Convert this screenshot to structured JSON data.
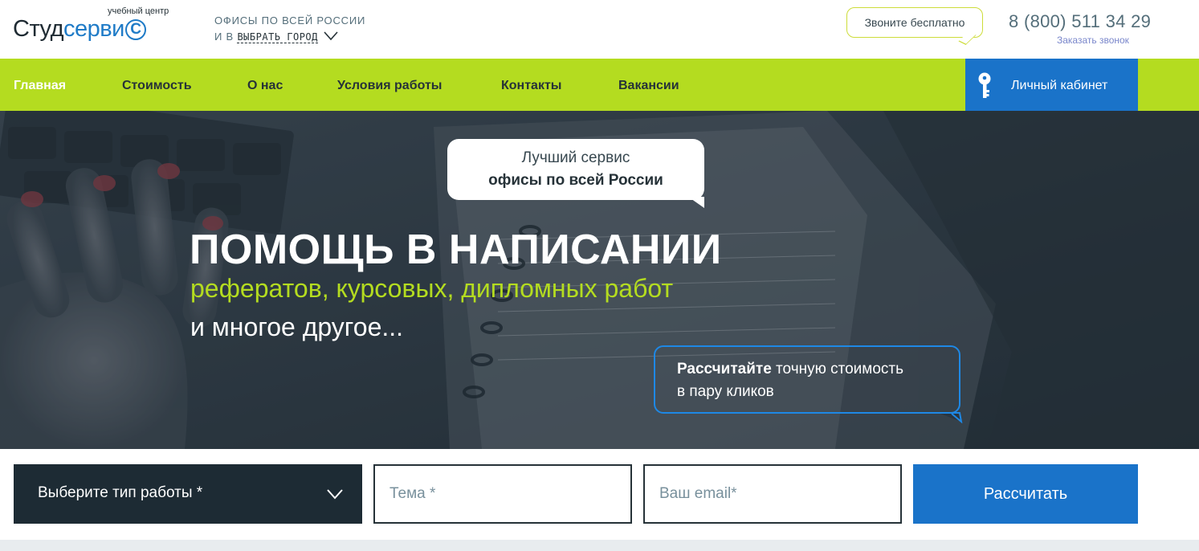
{
  "header": {
    "logo_small": "учебный центр",
    "logo_part1": "Студ",
    "logo_part2": "серви",
    "logo_c": "С",
    "offices_line1": "ОФИСЫ ПО ВСЕЙ РОССИИ",
    "offices_prefix": "И В",
    "city_select": "ВЫБРАТЬ ГОРОД",
    "call_free": "Звоните бесплатно",
    "phone": "8 (800) 511 34 29",
    "order_call": "Заказать звонок"
  },
  "nav": {
    "items": [
      {
        "label": "Главная"
      },
      {
        "label": "Стоимость"
      },
      {
        "label": "О нас"
      },
      {
        "label": "Условия работы"
      },
      {
        "label": "Контакты"
      },
      {
        "label": "Вакансии"
      }
    ],
    "cabinet": "Личный кабинет"
  },
  "hero": {
    "bubble_line1": "Лучший сервис",
    "bubble_line2": "офисы по всей России",
    "title": "ПОМОЩЬ В НАПИСАНИИ",
    "subtitle": "рефератов, курсовых, дипломных работ",
    "tagline": "и многое другое...",
    "calc_bold": "Рассчитайте",
    "calc_rest": " точную стоимость",
    "calc_line2": "в пару кликов"
  },
  "form": {
    "work_type": "Выберите тип работы *",
    "topic_placeholder": "Тема *",
    "email_placeholder": "Ваш email*",
    "submit": "Рассчитать"
  },
  "colors": {
    "accent_green": "#b4dc20",
    "accent_blue": "#1a73c9",
    "dark": "#1d2b34"
  }
}
